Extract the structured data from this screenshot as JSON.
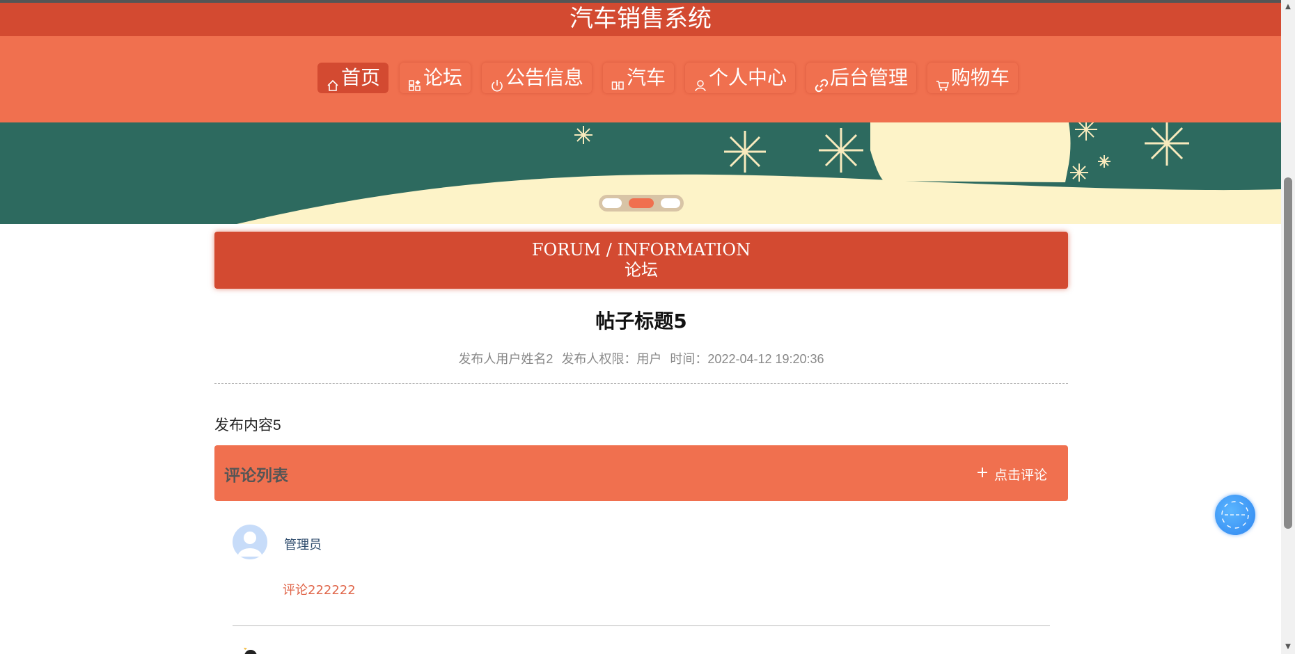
{
  "app": {
    "title": "汽车销售系统"
  },
  "nav": {
    "items": [
      {
        "label": "首页",
        "icon": "home-icon",
        "active": true
      },
      {
        "label": "论坛",
        "icon": "grid-icon",
        "active": false
      },
      {
        "label": "公告信息",
        "icon": "power-icon",
        "active": false
      },
      {
        "label": "汽车",
        "icon": "car-icon",
        "active": false
      },
      {
        "label": "个人中心",
        "icon": "user-icon",
        "active": false
      },
      {
        "label": "后台管理",
        "icon": "link-icon",
        "active": false
      },
      {
        "label": "购物车",
        "icon": "cart-icon",
        "active": false
      }
    ]
  },
  "banner": {
    "slide_count": 3,
    "active_slide": 2
  },
  "section": {
    "title_en": "FORUM / INFORMATION",
    "title_cn": "论坛"
  },
  "post": {
    "title": "帖子标题5",
    "author": "发布人用户姓名2",
    "role": "发布人权限：用户",
    "time": "时间：2022-04-12 19:20:36",
    "content": "发布内容5"
  },
  "comments": {
    "header": "评论列表",
    "add_label": "点击评论",
    "items": [
      {
        "user": "管理员",
        "text": "评论222222"
      }
    ]
  },
  "colors": {
    "primary": "#d34a31",
    "secondary": "#f0704f",
    "banner_green": "#2d6a5f",
    "banner_cream": "#fdf3c8"
  }
}
